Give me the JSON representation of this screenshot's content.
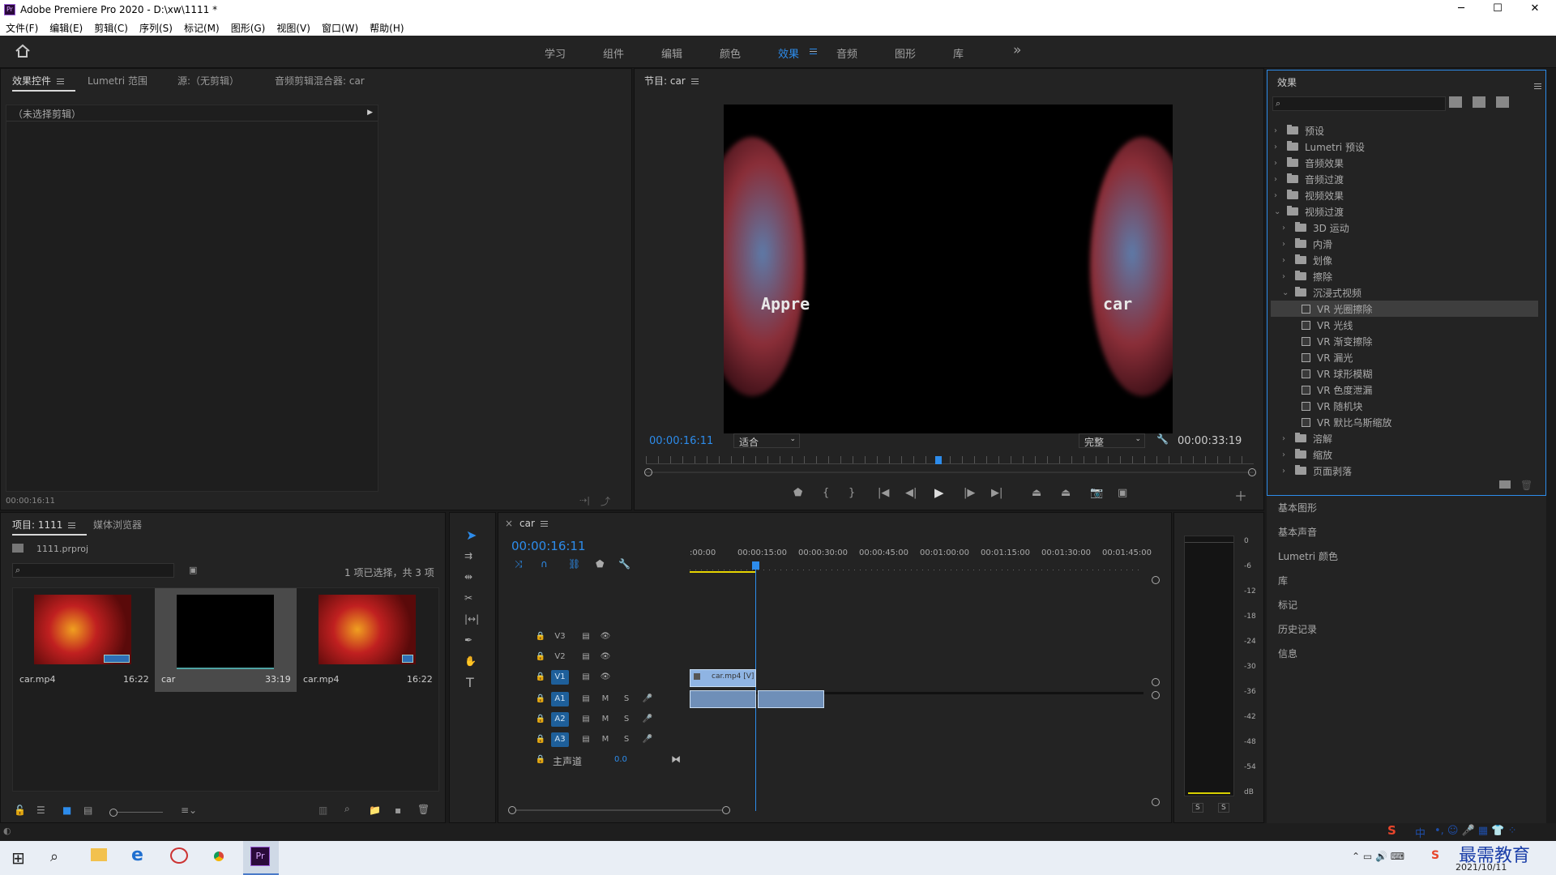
{
  "window": {
    "title": "Adobe Premiere Pro 2020 - D:\\xw\\1111 *",
    "minimize": "─",
    "maximize": "☐",
    "close": "✕"
  },
  "menu": [
    "文件(F)",
    "编辑(E)",
    "剪辑(C)",
    "序列(S)",
    "标记(M)",
    "图形(G)",
    "视图(V)",
    "窗口(W)",
    "帮助(H)"
  ],
  "workspaces": {
    "tabs": [
      "学习",
      "组件",
      "编辑",
      "颜色",
      "效果",
      "音频",
      "图形",
      "库"
    ],
    "active": "效果",
    "more": "»"
  },
  "source_panel": {
    "tabs": [
      "效果控件",
      "Lumetri 范围",
      "源:（无剪辑）",
      "音频剪辑混合器: car"
    ],
    "no_clip": "（未选择剪辑）",
    "timecode": "00:00:16:11"
  },
  "program": {
    "title": "节目: car",
    "timecode": "00:00:16:11",
    "fit": "适合",
    "quality": "完整",
    "duration": "00:00:33:19",
    "video_text_left": "Appre",
    "video_text_right": "car"
  },
  "effects": {
    "title": "效果",
    "search_placeholder": "",
    "items": [
      {
        "label": "预设",
        "type": "bin",
        "depth": 0,
        "open": false
      },
      {
        "label": "Lumetri 预设",
        "type": "bin",
        "depth": 0,
        "open": false
      },
      {
        "label": "音频效果",
        "type": "folder",
        "depth": 0,
        "open": false
      },
      {
        "label": "音频过渡",
        "type": "folder",
        "depth": 0,
        "open": false
      },
      {
        "label": "视频效果",
        "type": "folder",
        "depth": 0,
        "open": false
      },
      {
        "label": "视频过渡",
        "type": "folder",
        "depth": 0,
        "open": true
      },
      {
        "label": "3D 运动",
        "type": "folder",
        "depth": 1,
        "open": false
      },
      {
        "label": "内滑",
        "type": "folder",
        "depth": 1,
        "open": false
      },
      {
        "label": "划像",
        "type": "folder",
        "depth": 1,
        "open": false
      },
      {
        "label": "擦除",
        "type": "folder",
        "depth": 1,
        "open": false
      },
      {
        "label": "沉浸式视频",
        "type": "folder",
        "depth": 1,
        "open": true
      },
      {
        "label": "VR 光圈擦除",
        "type": "fx",
        "depth": 2,
        "selected": true
      },
      {
        "label": "VR 光线",
        "type": "fx",
        "depth": 2
      },
      {
        "label": "VR 渐变擦除",
        "type": "fx",
        "depth": 2
      },
      {
        "label": "VR 漏光",
        "type": "fx",
        "depth": 2
      },
      {
        "label": "VR 球形模糊",
        "type": "fx",
        "depth": 2
      },
      {
        "label": "VR 色度泄漏",
        "type": "fx",
        "depth": 2
      },
      {
        "label": "VR 随机块",
        "type": "fx",
        "depth": 2
      },
      {
        "label": "VR 默比乌斯缩放",
        "type": "fx",
        "depth": 2
      },
      {
        "label": "溶解",
        "type": "folder",
        "depth": 1,
        "open": false
      },
      {
        "label": "缩放",
        "type": "folder",
        "depth": 1,
        "open": false
      },
      {
        "label": "页面剥落",
        "type": "folder",
        "depth": 1,
        "open": false
      }
    ]
  },
  "side_panels": [
    "基本图形",
    "基本声音",
    "Lumetri 颜色",
    "库",
    "标记",
    "历史记录",
    "信息"
  ],
  "project": {
    "tabs": [
      "项目: 1111",
      "媒体浏览器"
    ],
    "file": "1111.prproj",
    "status": "1 项已选择，共 3 项",
    "items": [
      {
        "name": "car.mp4",
        "duration": "16:22"
      },
      {
        "name": "car",
        "duration": "33:19"
      },
      {
        "name": "car.mp4",
        "duration": "16:22"
      }
    ]
  },
  "timeline": {
    "tab": "car",
    "timecode": "00:00:16:11",
    "ruler": [
      ":00:00",
      "00:00:15:00",
      "00:00:30:00",
      "00:00:45:00",
      "00:01:00:00",
      "00:01:15:00",
      "00:01:30:00",
      "00:01:45:00"
    ],
    "video_tracks": [
      "V3",
      "V2",
      "V1"
    ],
    "audio_tracks": [
      "A1",
      "A2",
      "A3"
    ],
    "master": "主声道",
    "master_value": "0.0",
    "clip_label": "car.mp4 [V]",
    "m": "M",
    "s": "S"
  },
  "meter": {
    "scale": [
      "0",
      "-6",
      "-12",
      "-18",
      "-24",
      "-30",
      "-36",
      "-42",
      "-48",
      "-54",
      "dB"
    ],
    "solo": [
      "S",
      "S"
    ]
  },
  "taskbar": {
    "date": "2021/10/11",
    "ime": "中",
    "watermark": "最需教育"
  }
}
